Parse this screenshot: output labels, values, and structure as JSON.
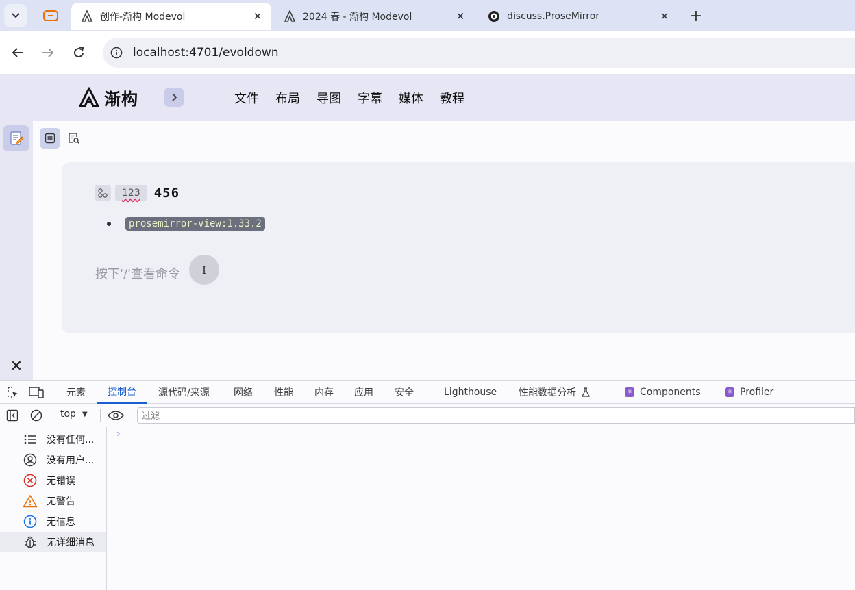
{
  "browser": {
    "tabs": [
      {
        "title": "创作-渐构 Modevol",
        "active": true,
        "icon": "modevol-logo-icon"
      },
      {
        "title": "2024 春 - 渐构 Modevol",
        "active": false,
        "icon": "modevol-logo-icon"
      },
      {
        "title": "discuss.ProseMirror",
        "active": false,
        "icon": "prosemirror-icon"
      }
    ],
    "address": "localhost:4701/evoldown"
  },
  "app": {
    "logo_text": "渐构",
    "nav": [
      "文件",
      "布局",
      "导图",
      "字幕",
      "媒体",
      "教程"
    ]
  },
  "editor": {
    "chip_label": "123",
    "heading": "456",
    "code_chip": "prosemirror-view:1.33.2",
    "placeholder": "按下'/'查看命令",
    "cursor_glyph": "I"
  },
  "devtools": {
    "tabs": [
      "元素",
      "控制台",
      "源代码/来源",
      "网络",
      "性能",
      "内存",
      "应用",
      "安全",
      "Lighthouse",
      "性能数据分析",
      "Components",
      "Profiler"
    ],
    "active_tab": "控制台",
    "context": "top",
    "filter_placeholder": "过滤",
    "sidebar": [
      "没有任何...",
      "没有用户...",
      "无错误",
      "无警告",
      "无信息",
      "无详细消息"
    ],
    "prompt": "›",
    "colors": {
      "accent": "#1a5fd0",
      "error": "#d93025",
      "warning": "#e8710a",
      "info": "#1a73e8"
    }
  }
}
